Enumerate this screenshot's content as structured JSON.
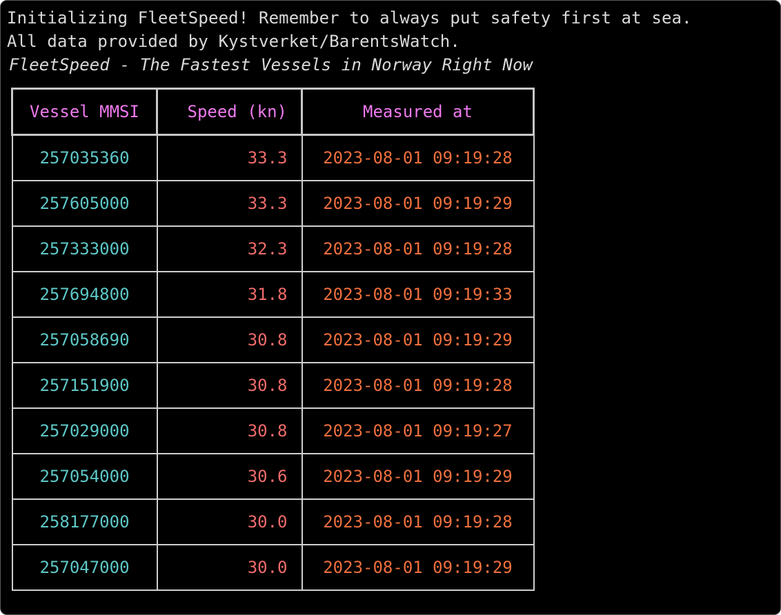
{
  "intro": {
    "line1": "Initializing FleetSpeed! Remember to always put safety first at sea.",
    "line2": "All data provided by Kystverket/BarentsWatch.",
    "title": "FleetSpeed - The Fastest Vessels in Norway Right Now"
  },
  "table": {
    "headers": [
      "Vessel MMSI",
      "Speed (kn)",
      "Measured at"
    ],
    "rows": [
      {
        "mmsi": "257035360",
        "speed": "33.3",
        "measured_at": "2023-08-01 09:19:28"
      },
      {
        "mmsi": "257605000",
        "speed": "33.3",
        "measured_at": "2023-08-01 09:19:29"
      },
      {
        "mmsi": "257333000",
        "speed": "32.3",
        "measured_at": "2023-08-01 09:19:28"
      },
      {
        "mmsi": "257694800",
        "speed": "31.8",
        "measured_at": "2023-08-01 09:19:33"
      },
      {
        "mmsi": "257058690",
        "speed": "30.8",
        "measured_at": "2023-08-01 09:19:29"
      },
      {
        "mmsi": "257151900",
        "speed": "30.8",
        "measured_at": "2023-08-01 09:19:28"
      },
      {
        "mmsi": "257029000",
        "speed": "30.8",
        "measured_at": "2023-08-01 09:19:27"
      },
      {
        "mmsi": "257054000",
        "speed": "30.6",
        "measured_at": "2023-08-01 09:19:29"
      },
      {
        "mmsi": "258177000",
        "speed": "30.0",
        "measured_at": "2023-08-01 09:19:28"
      },
      {
        "mmsi": "257047000",
        "speed": "30.0",
        "measured_at": "2023-08-01 09:19:29"
      }
    ]
  },
  "colors": {
    "background": "#000000",
    "text": "#d9d9d9",
    "header": "#ee7aee",
    "mmsi": "#5ec7c7",
    "speed": "#f06b6b",
    "timestamp": "#ef6f3d",
    "border": "#c8c8c8"
  }
}
